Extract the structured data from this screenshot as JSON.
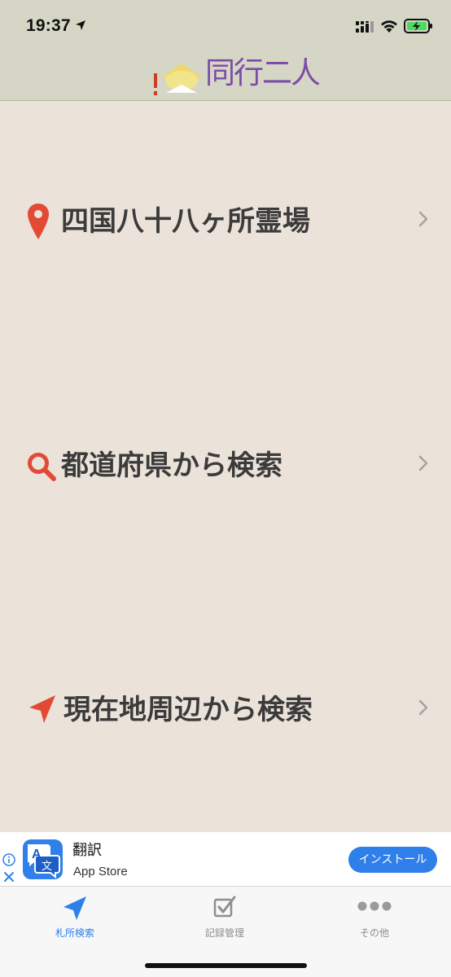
{
  "status_bar": {
    "time": "19:37"
  },
  "header": {
    "logo_text": "同行二人"
  },
  "menu": {
    "items": [
      {
        "label": "四国八十八ヶ所霊場",
        "icon": "map-pin-icon",
        "icon_color": "#e24a36"
      },
      {
        "label": "都道府県から検索",
        "icon": "search-icon",
        "icon_color": "#e24a36"
      },
      {
        "label": "現在地周辺から検索",
        "icon": "location-arrow-icon",
        "icon_color": "#e24a36"
      }
    ]
  },
  "ad": {
    "title": "翻訳",
    "subtitle": "App Store",
    "install_label": "インストール",
    "app_icon_glyphs": {
      "a": "A",
      "b": "文"
    }
  },
  "tab_bar": {
    "tabs": [
      {
        "label": "札所検索",
        "icon": "location-arrow-icon",
        "active": true
      },
      {
        "label": "記録管理",
        "icon": "checkbox-edit-icon",
        "active": false
      },
      {
        "label": "その他",
        "icon": "more-dots-icon",
        "active": false
      }
    ]
  },
  "colors": {
    "background": "#ebe2da",
    "header": "#d5d6c5",
    "accent": "#2f80ea",
    "menu_icon": "#e24a36",
    "logo_text": "#7b4ca8"
  }
}
